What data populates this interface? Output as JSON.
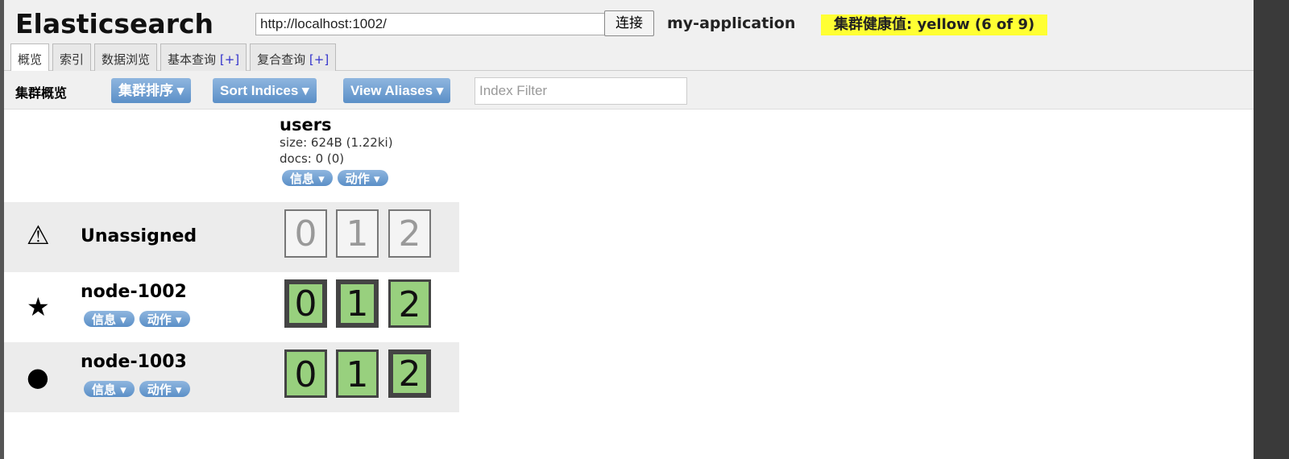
{
  "header": {
    "title": "Elasticsearch",
    "url": "http://localhost:1002/",
    "connect_label": "连接",
    "cluster_name": "my-application",
    "health": "集群健康值: yellow (6 of 9)"
  },
  "tabs": [
    {
      "label": "概览"
    },
    {
      "label": "索引"
    },
    {
      "label": "数据浏览"
    },
    {
      "label": "基本查询",
      "plus": "[+]"
    },
    {
      "label": "复合查询",
      "plus": "[+]"
    }
  ],
  "toolbar": {
    "label": "集群概览",
    "sort_cluster": "集群排序 ▾",
    "sort_indices": "Sort Indices ▾",
    "view_aliases": "View Aliases ▾",
    "filter_placeholder": "Index Filter"
  },
  "index": {
    "name": "users",
    "size": "size: 624B (1.22ki)",
    "docs": "docs: 0 (0)",
    "info": "信息 ▾",
    "action": "动作 ▾"
  },
  "rows": [
    {
      "name": "Unassigned",
      "icon": "⚠",
      "shards": [
        "0",
        "1",
        "2"
      ]
    },
    {
      "name": "node-1002",
      "icon": "★",
      "info": "信息 ▾",
      "action": "动作 ▾",
      "shards": [
        "0",
        "1",
        "2"
      ]
    },
    {
      "name": "node-1003",
      "icon": "●",
      "info": "信息 ▾",
      "action": "动作 ▾",
      "shards": [
        "0",
        "1",
        "2"
      ]
    }
  ]
}
